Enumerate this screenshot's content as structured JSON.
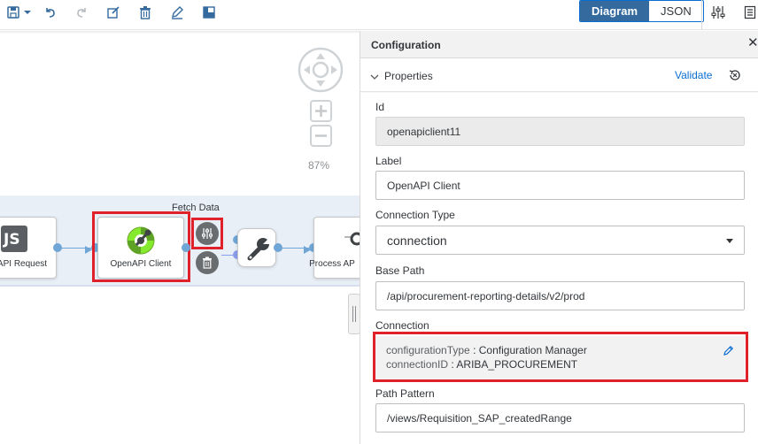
{
  "toolbar": {
    "icons": [
      "save-icon",
      "dropdown-caret-icon",
      "undo-icon",
      "redo-icon",
      "edit-box-icon",
      "trash-icon",
      "pencil-icon",
      "layout-icon"
    ],
    "view_diagram": "Diagram",
    "view_json": "JSON",
    "right_icons": [
      "settings-sliders-icon",
      "document-icon"
    ]
  },
  "canvas": {
    "zoom": "87%",
    "lane_title": "Fetch Data",
    "nodes": {
      "api_request": "API Request",
      "openapi_client": "OpenAPI Client",
      "process": "Process AP"
    }
  },
  "panel": {
    "title": "Configuration",
    "section": "Properties",
    "validate": "Validate",
    "fields": {
      "id_label": "Id",
      "id_value": "openapiclient11",
      "label_label": "Label",
      "label_value": "OpenAPI Client",
      "conntype_label": "Connection Type",
      "conntype_value": "connection",
      "basepath_label": "Base Path",
      "basepath_value": "/api/procurement-reporting-details/v2/prod",
      "connection_label": "Connection",
      "config_type_key": "configurationType",
      "config_type_value": "Configuration Manager",
      "connection_id_key": "connectionID",
      "connection_id_value": "ARIBA_PROCUREMENT",
      "pathpattern_label": "Path Pattern",
      "pathpattern_value": "/views/Requisition_SAP_createdRange"
    }
  },
  "colors": {
    "accent": "#0a6ed1",
    "highlight": "#e0202a",
    "lane": "#e9eff7"
  }
}
